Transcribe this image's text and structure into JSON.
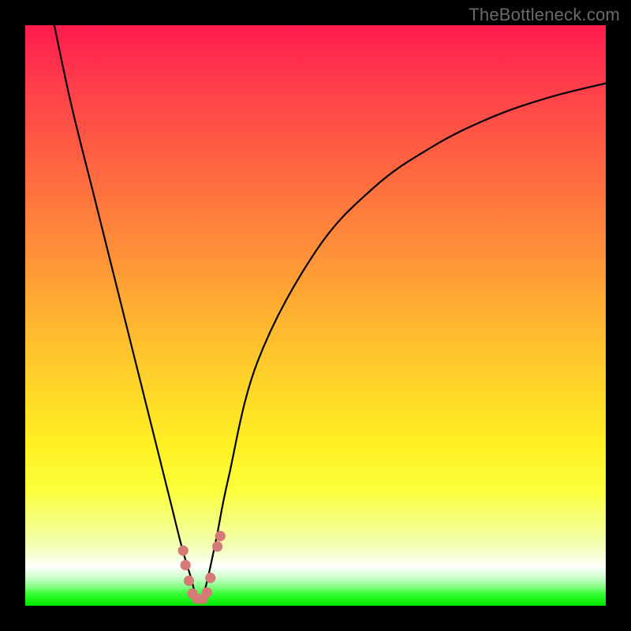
{
  "watermark": {
    "text": "TheBottleneck.com"
  },
  "chart_data": {
    "type": "line",
    "title": "",
    "xlabel": "",
    "ylabel": "",
    "xlim": [
      0,
      100
    ],
    "ylim": [
      0,
      100
    ],
    "grid": false,
    "legend": false,
    "background": "gradient-red-yellow-green-vertical",
    "series": [
      {
        "name": "bottleneck-curve",
        "color": "#000000",
        "x": [
          5,
          8,
          12,
          16,
          20,
          23,
          25,
          27,
          28.5,
          29.5,
          30.5,
          31.5,
          33,
          35,
          40,
          50,
          60,
          70,
          80,
          90,
          100
        ],
        "y": [
          100,
          86,
          70,
          54,
          38,
          26,
          18,
          10,
          5,
          1.5,
          1.5,
          5,
          12,
          22,
          42,
          61,
          72,
          79,
          84,
          87.5,
          90
        ]
      }
    ],
    "markers": [
      {
        "name": "valley-dots",
        "color": "#d67a77",
        "radius_percent": 0.9,
        "points": [
          {
            "x": 27.2,
            "y": 9.5
          },
          {
            "x": 27.6,
            "y": 7.0
          },
          {
            "x": 28.2,
            "y": 4.3
          },
          {
            "x": 28.8,
            "y": 2.1
          },
          {
            "x": 29.6,
            "y": 1.2
          },
          {
            "x": 30.6,
            "y": 1.2
          },
          {
            "x": 31.3,
            "y": 2.3
          },
          {
            "x": 31.9,
            "y": 4.8
          },
          {
            "x": 33.1,
            "y": 10.2
          },
          {
            "x": 33.6,
            "y": 12.0
          }
        ]
      }
    ]
  }
}
